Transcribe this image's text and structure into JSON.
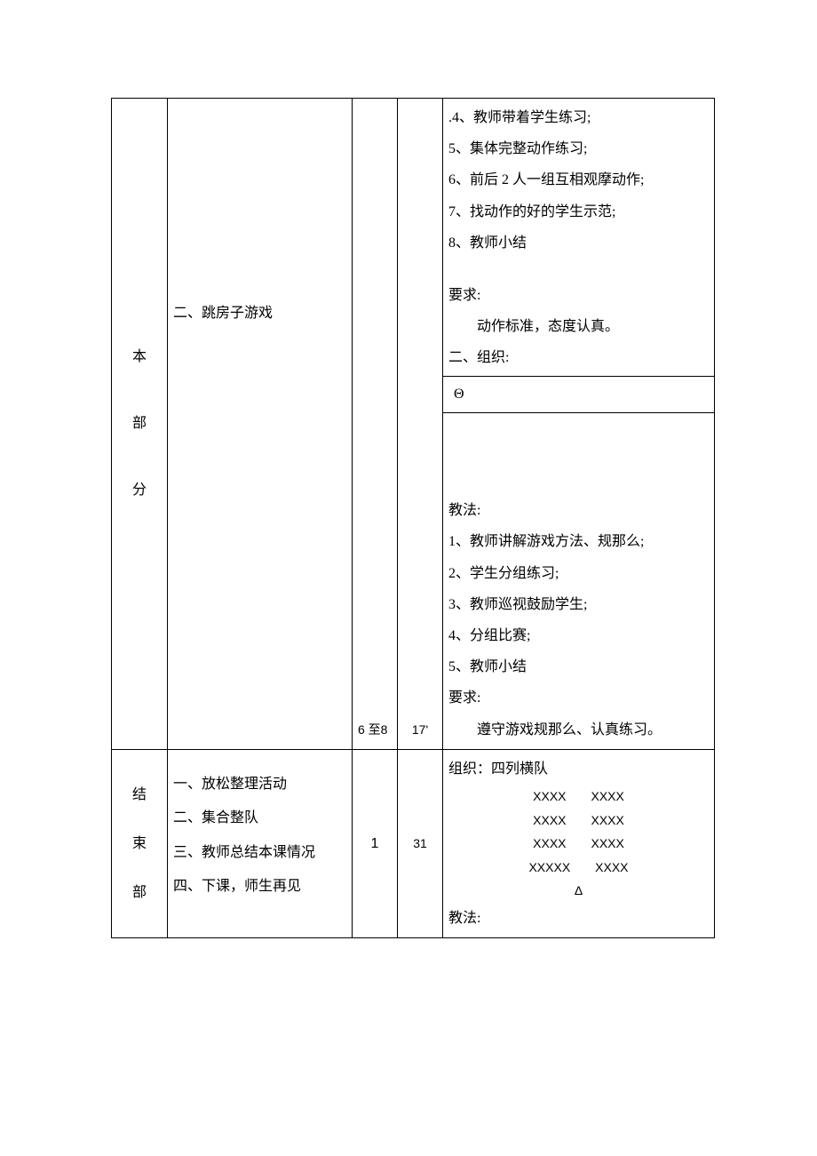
{
  "row1": {
    "section": [
      "本",
      "部",
      "分"
    ],
    "content_item": "二、跳房子游戏",
    "num1": "6 至8",
    "num2": "17'",
    "detail": {
      "p1": ".4、教师带着学生练习;",
      "p2": "5、集体完整动作练习;",
      "p3": "6、前后 2 人一组互相观摩动作;",
      "p4": "7、找动作的好的学生示范;",
      "p5": "8、教师小结",
      "req_label": "要求:",
      "req_text": "动作标准，态度认真。",
      "org_label": "二、组织:",
      "org_symbol": "Θ",
      "method_label": "教法:",
      "m1": "1、教师讲解游戏方法、规那么;",
      "m2": "2、学生分组练习;",
      "m3": "3、教师巡视鼓励学生;",
      "m4": "4、分组比赛;",
      "m5": "5、教师小结",
      "req2_label": "要求:",
      "req2_text": "遵守游戏规那么、认真练习。"
    }
  },
  "row2": {
    "section": [
      "结",
      "束",
      "部"
    ],
    "c1": "一、放松整理活动",
    "c2": "二、集合整队",
    "c3": "三、教师总结本课情况",
    "c4": "四、下课，师生再见",
    "num1": "1",
    "num2": "31",
    "detail": {
      "org_label": "组织：四列横队",
      "f1": "XXXX　　XXXX",
      "f2": "XXXX　　XXXX",
      "f3": "XXXX　　XXXX",
      "f4": "XXXXX　　XXXX",
      "tri": "Δ",
      "method_label": "教法:"
    }
  }
}
